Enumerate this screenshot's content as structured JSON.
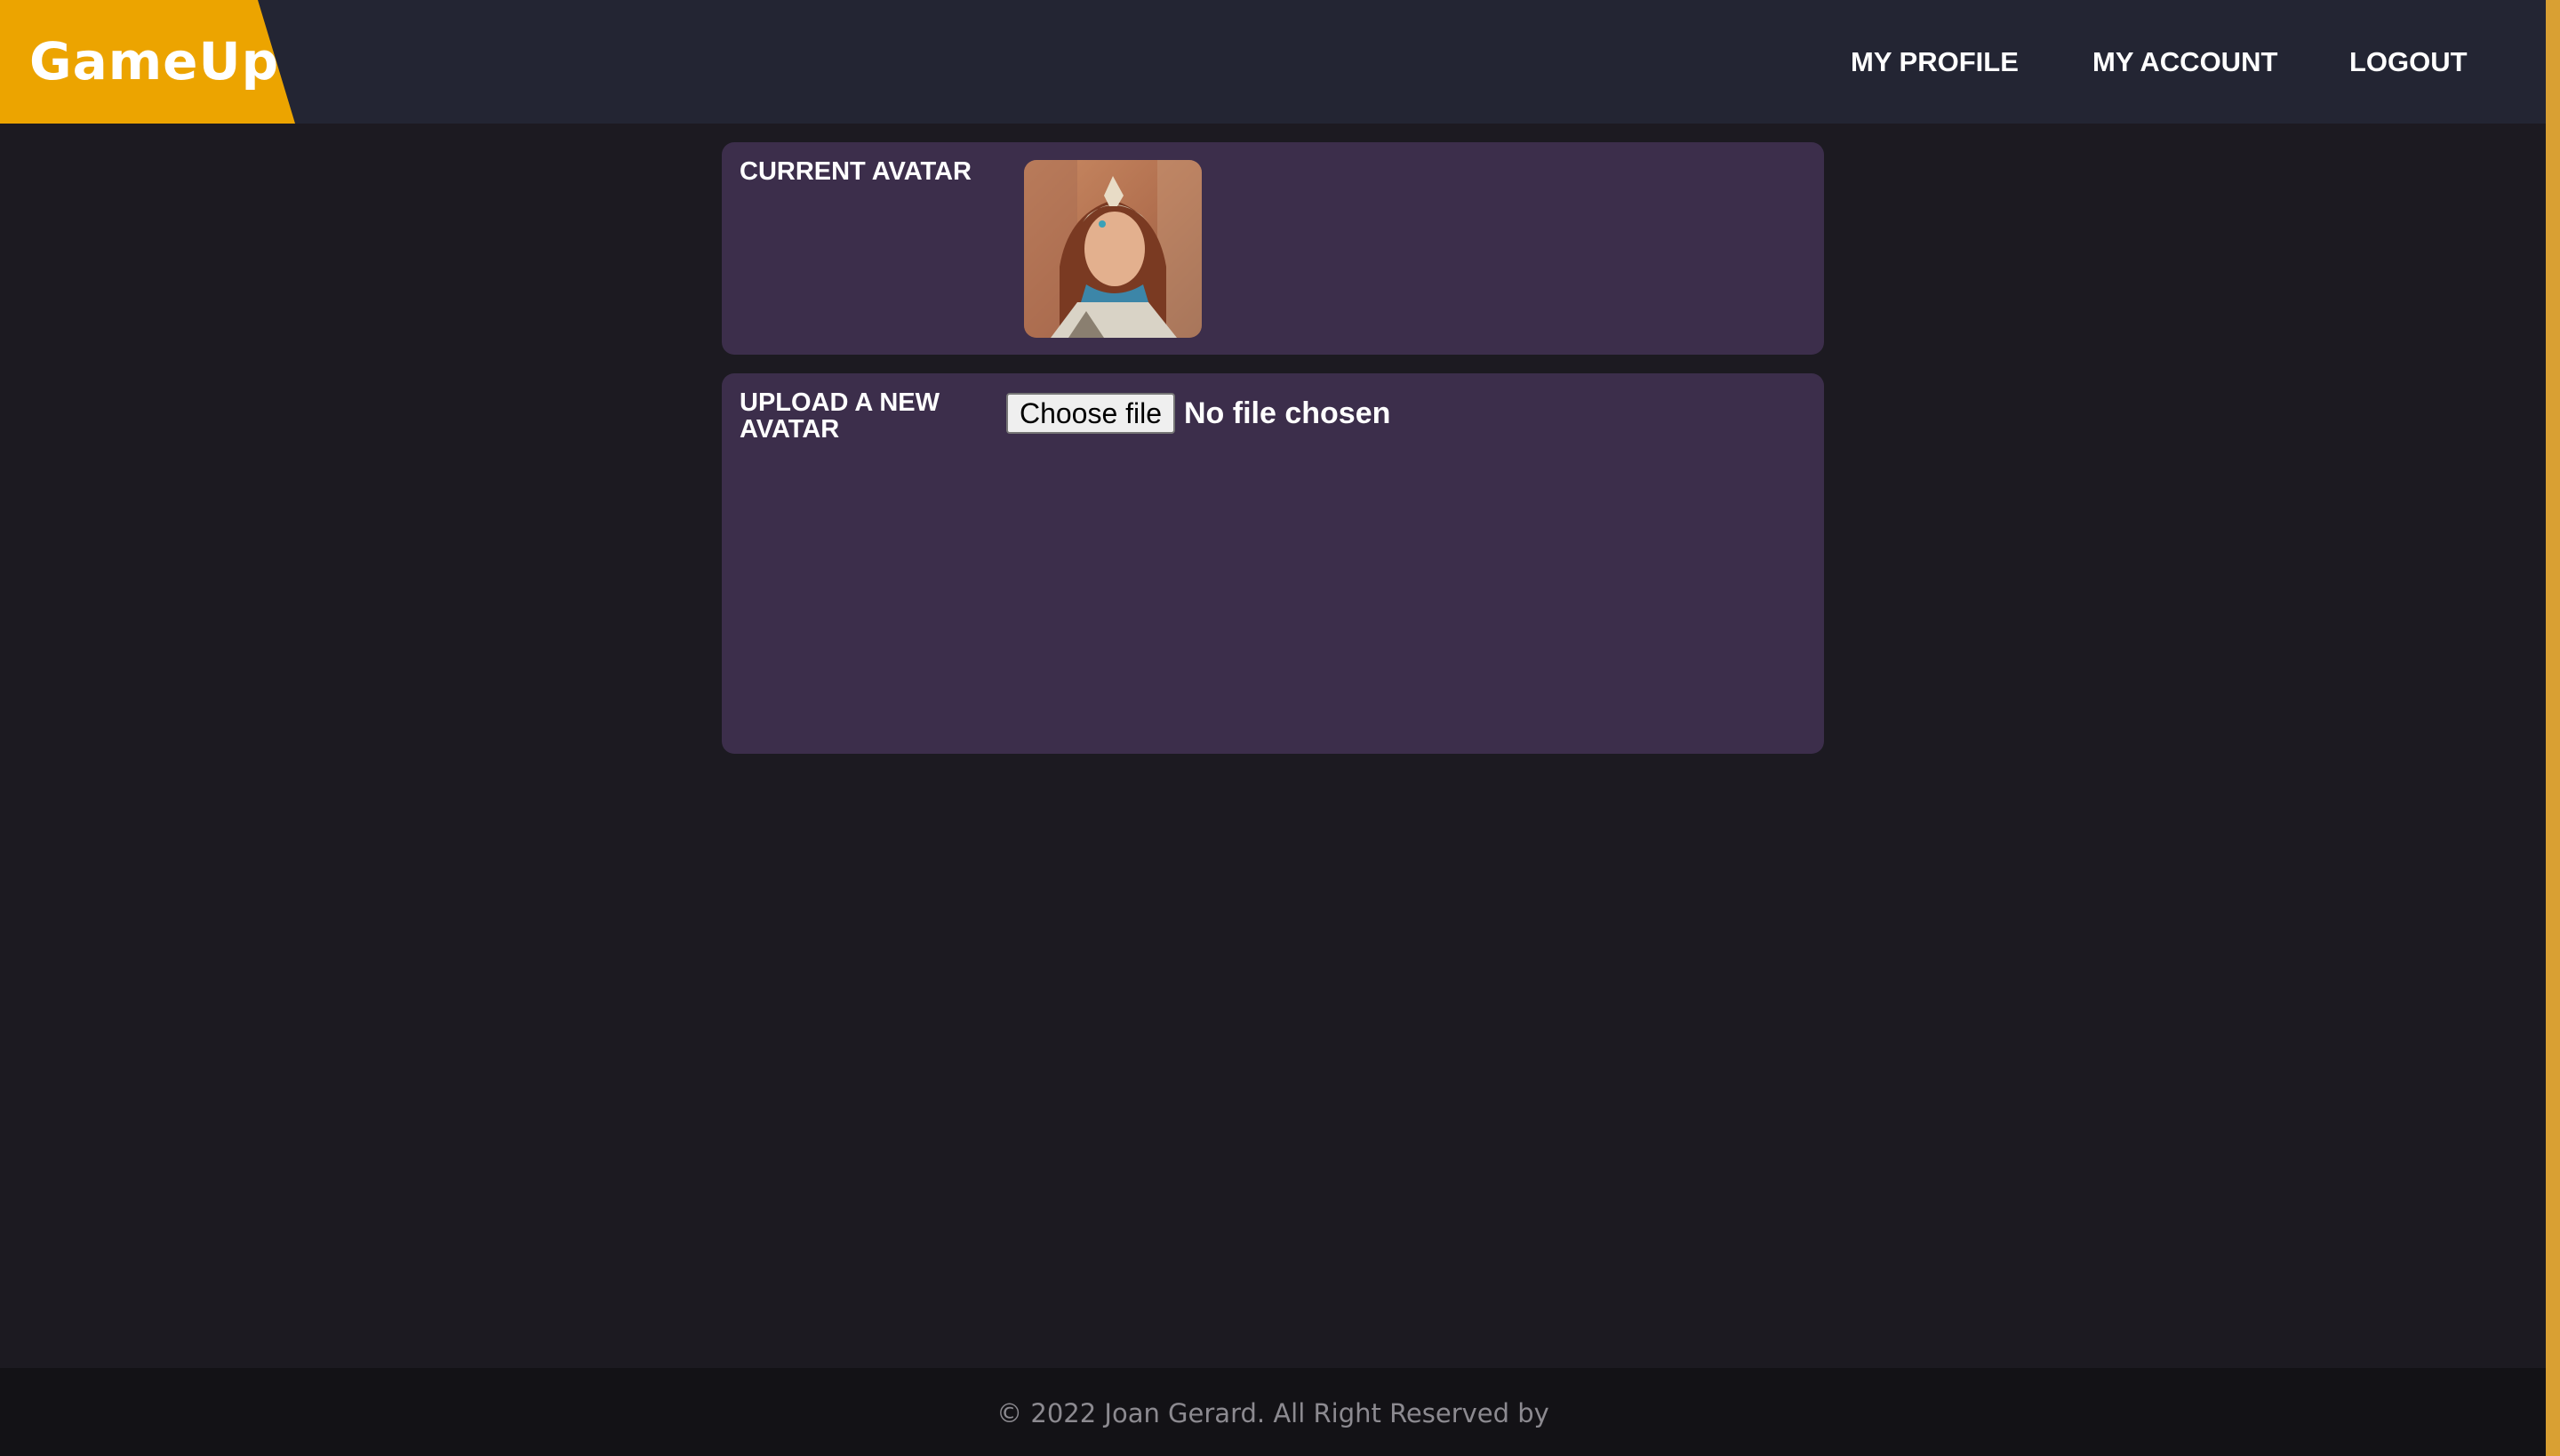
{
  "header": {
    "logo": "GameUp",
    "nav": {
      "profile": "MY PROFILE",
      "account": "MY ACCOUNT",
      "logout": "LOGOUT"
    }
  },
  "current_avatar": {
    "label": "CURRENT AVATAR",
    "image_icon": "avatar-portrait-icon"
  },
  "upload": {
    "label": "UPLOAD A NEW AVATAR",
    "button_label": "Choose file",
    "status": "No file chosen"
  },
  "footer": {
    "text": "© 2022 Joan Gerard. All Right Reserved by"
  },
  "colors": {
    "brand": "#eca400",
    "header_bg": "#232533",
    "page_bg": "#1c1a21",
    "card_bg": "#3c2e4b",
    "footer_bg": "#131216"
  }
}
